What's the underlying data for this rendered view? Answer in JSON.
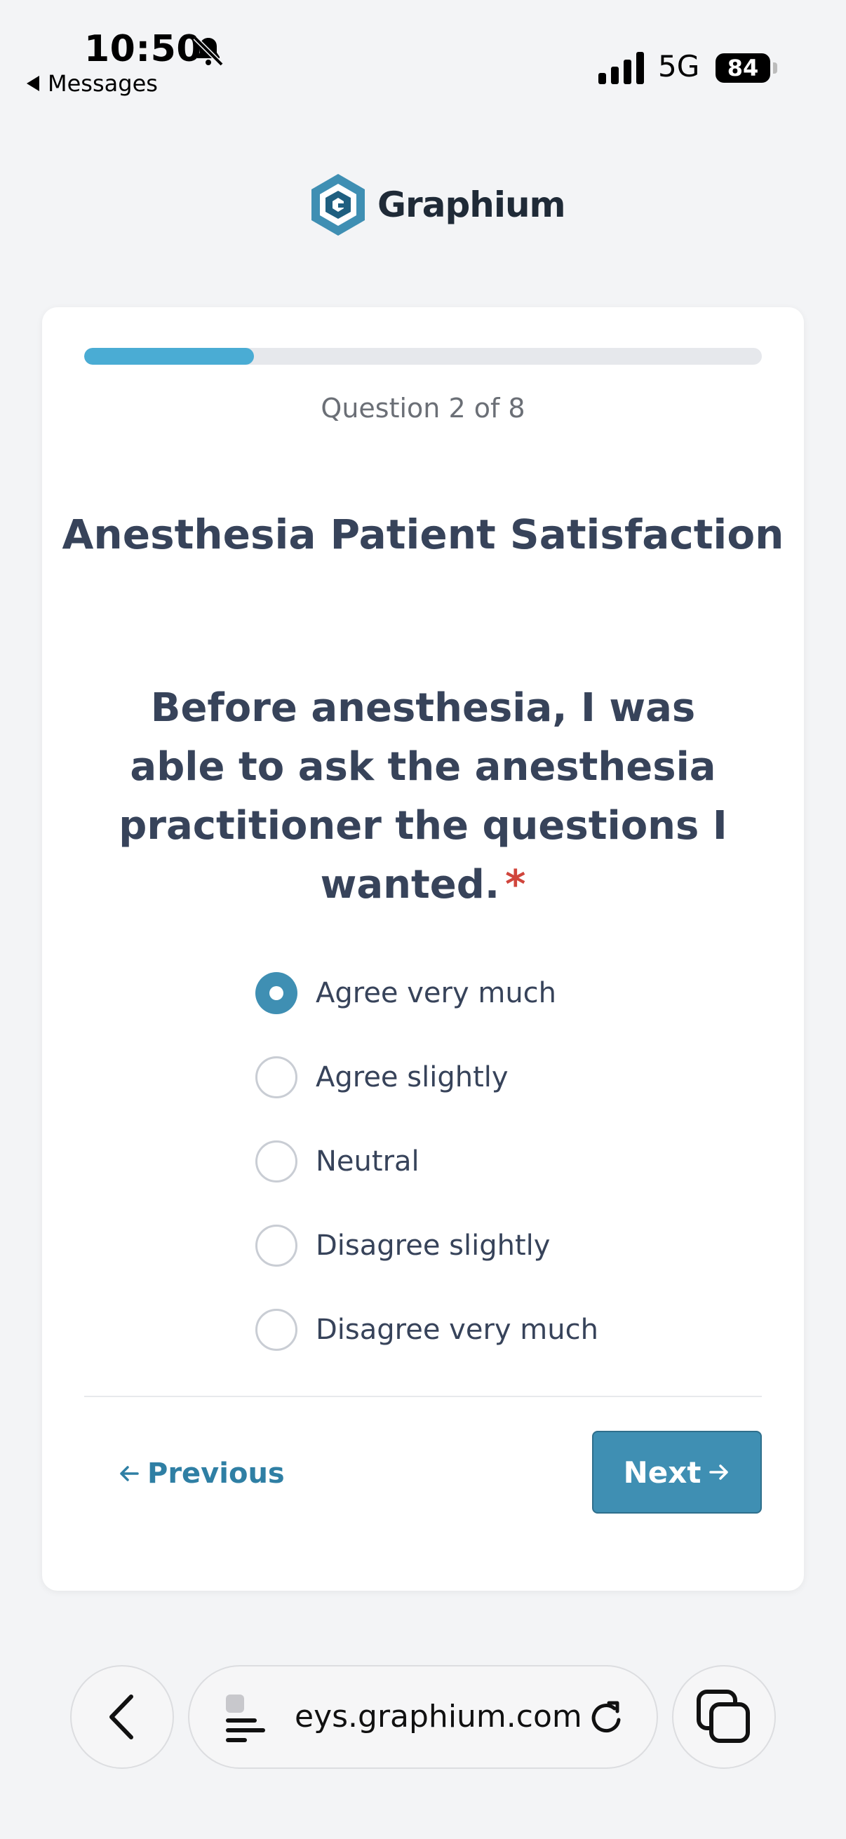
{
  "status_bar": {
    "time": "10:50",
    "back_label": "Messages",
    "network": "5G",
    "battery": "84"
  },
  "logo": {
    "text": "Graphium"
  },
  "progress": {
    "fraction": 0.25
  },
  "counter": "Question 2 of 8",
  "survey_title": "Anesthesia Patient Satisfaction",
  "question": {
    "text": "Before anesthesia, I was able to ask the anesthesia practitioner the questions I wanted.",
    "required_mark": "*"
  },
  "options": [
    {
      "label": "Agree very much",
      "checked": true
    },
    {
      "label": "Agree slightly",
      "checked": false
    },
    {
      "label": "Neutral",
      "checked": false
    },
    {
      "label": "Disagree slightly",
      "checked": false
    },
    {
      "label": "Disagree very much",
      "checked": false
    }
  ],
  "nav": {
    "previous": "Previous",
    "next": "Next"
  },
  "browser": {
    "url": "eys.graphium.com"
  },
  "colors": {
    "accent": "#3f8fb3",
    "progress": "#4aacd4",
    "required": "#d0453c"
  }
}
